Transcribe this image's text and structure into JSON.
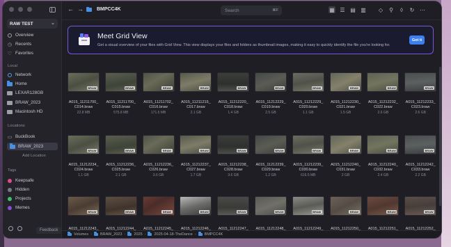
{
  "sidebar": {
    "library": "RAW TEST",
    "top_items": [
      {
        "label": "Overview",
        "icon": "overview-icon"
      },
      {
        "label": "Recents",
        "icon": "clock-icon"
      },
      {
        "label": "Favorites",
        "icon": "heart-icon"
      }
    ],
    "local_heading": "Local",
    "local_items": [
      {
        "label": "Network",
        "icon": "network-icon"
      },
      {
        "label": "Home",
        "icon": "folder-icon"
      },
      {
        "label": "LEXAR128GB",
        "icon": "drive-icon"
      },
      {
        "label": "BRAW_2023",
        "icon": "drive-icon"
      },
      {
        "label": "Macintosh HD",
        "icon": "drive-icon"
      }
    ],
    "locations_heading": "Locations",
    "location_items": [
      {
        "label": "BuckBook",
        "icon": "laptop-icon"
      },
      {
        "label": "BRAW_2023",
        "icon": "folder-icon"
      }
    ],
    "add_location": "Add Location",
    "tags_heading": "Tags",
    "tags": [
      {
        "label": "Keepsafe",
        "color": "#e04a8c"
      },
      {
        "label": "Hidden",
        "color": "#7a7a86"
      },
      {
        "label": "Projects",
        "color": "#3fbf6a"
      },
      {
        "label": "Memes",
        "color": "#8a4ad8"
      }
    ],
    "feedback": "Feedback"
  },
  "toolbar": {
    "title": "BMPCC4K",
    "search_placeholder": "Search",
    "search_shortcut": "⌘F"
  },
  "banner": {
    "title": "Meet Grid View",
    "description": "Get a visual overview of your files with Grid View. This view displays your files and folders as thumbnail images, making it easy to quickly identify the file you're looking for.",
    "button": "Got it"
  },
  "badge": "BRAW",
  "files_row1": [
    {
      "name": "A015_11211700_",
      "name2": "C014.braw",
      "size": "22.8 MB"
    },
    {
      "name": "A015_11211700_",
      "name2": "C015.braw",
      "size": "575.8 MB"
    },
    {
      "name": "A015_11211702_",
      "name2": "C016.braw",
      "size": "171.5 MB"
    },
    {
      "name": "A015_11211215_",
      "name2": "C017.braw",
      "size": "2.1 GB"
    },
    {
      "name": "A015_11212220_",
      "name2": "C018.braw",
      "size": "1.4 GB"
    },
    {
      "name": "A015_11212229_",
      "name2": "C019.braw",
      "size": "2.5 GB"
    },
    {
      "name": "A015_11212229_",
      "name2": "C020.braw",
      "size": "1.1 GB"
    },
    {
      "name": "A015_11212230_",
      "name2": "C021.braw",
      "size": "1.5 GB"
    },
    {
      "name": "A015_11212232_",
      "name2": "C022.braw",
      "size": "2.6 GB"
    },
    {
      "name": "A015_11212233_",
      "name2": "C023.braw",
      "size": "2.6 GB"
    }
  ],
  "files_row2": [
    {
      "name": "A015_11212234_",
      "name2": "C024.braw",
      "size": "1.1 GB"
    },
    {
      "name": "A015_11212236_",
      "name2": "C025.braw",
      "size": "2.1 GB"
    },
    {
      "name": "A015_11212236_",
      "name2": "C026.braw",
      "size": "3.6 GB"
    },
    {
      "name": "A015_11212237_",
      "name2": "C027.braw",
      "size": "1.7 GB"
    },
    {
      "name": "A015_11212238_",
      "name2": "C028.braw",
      "size": "3.6 GB"
    },
    {
      "name": "A015_11212239_",
      "name2": "C029.braw",
      "size": "1.2 GB"
    },
    {
      "name": "A015_11212239_",
      "name2": "C030.braw",
      "size": "616.5 MB"
    },
    {
      "name": "A015_11212240_",
      "name2": "C031.braw",
      "size": "2 GB"
    },
    {
      "name": "A015_11212240_",
      "name2": "C032.braw",
      "size": "2.4 GB"
    },
    {
      "name": "A015_11212242_",
      "name2": "C033.braw",
      "size": "2.2 GB"
    }
  ],
  "files_row3": [
    {
      "name": "A015_11212243_"
    },
    {
      "name": "A015_11212244_"
    },
    {
      "name": "A015_11212245_"
    },
    {
      "name": "A015_11212246_"
    },
    {
      "name": "A015_11212247_"
    },
    {
      "name": "A015_11212248_"
    },
    {
      "name": "A015_11212249_"
    },
    {
      "name": "A015_11212250_"
    },
    {
      "name": "A015_11212251_"
    },
    {
      "name": "A015_11212252_"
    }
  ],
  "pathbar": [
    "Volumes",
    "BRAW_2023",
    "2025",
    "2025-04-18-TheDance",
    "BMPCC4K"
  ]
}
